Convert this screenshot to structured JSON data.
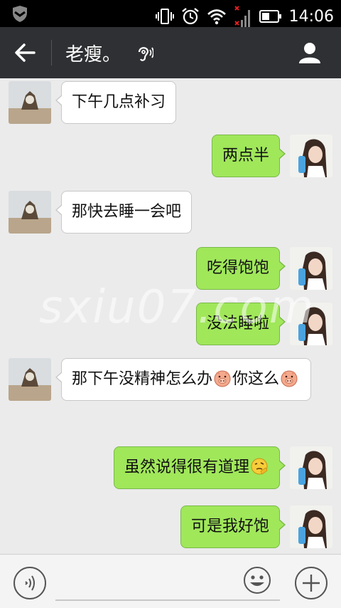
{
  "status_bar": {
    "time": "14:06",
    "icons": [
      "shield-icon",
      "vibrate-icon",
      "alarm-icon",
      "wifi-icon",
      "no-signal-icon",
      "battery-icon"
    ]
  },
  "header": {
    "title": "老瘦。",
    "back_icon": "back-arrow-icon",
    "earpiece_icon": "earpiece-icon",
    "contact_icon": "contact-profile-icon"
  },
  "messages": [
    {
      "side": "in",
      "text": "下午几点补习"
    },
    {
      "side": "out",
      "text": "两点半"
    },
    {
      "side": "in",
      "text": "那快去睡一会吧"
    },
    {
      "side": "out",
      "text": "吃得饱饱"
    },
    {
      "side": "out",
      "text": "没法睡啦"
    },
    {
      "side": "in",
      "text_a": "那下午没精神怎么办",
      "text_b": "你这么",
      "emoji": "pig-emoji"
    },
    {
      "side": "out",
      "text": "虽然说得很有道理",
      "emoji": "thinking-emoji"
    },
    {
      "side": "out",
      "text": "可是我好饱"
    }
  ],
  "watermark": "sxiu07.com",
  "input_bar": {
    "voice_icon": "voice-input-icon",
    "emoji_icon": "smiley-icon",
    "plus_icon": "plus-icon",
    "placeholder": ""
  },
  "colors": {
    "header_bg": "#2f3033",
    "chat_bg": "#ebebeb",
    "outgoing_bubble": "#a0e75a",
    "incoming_bubble": "#ffffff"
  }
}
